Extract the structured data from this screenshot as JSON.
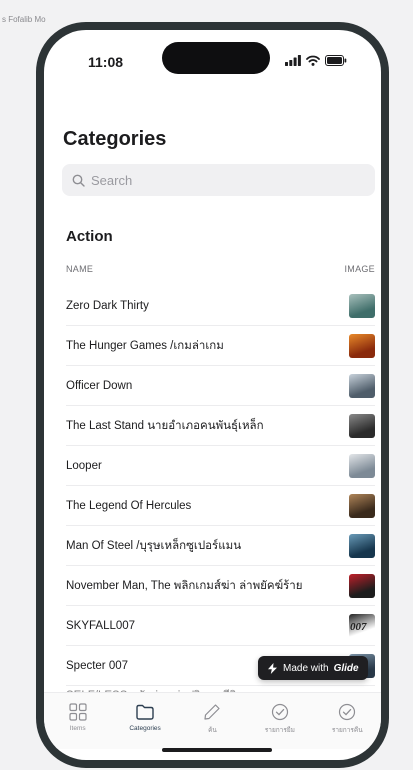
{
  "window": {
    "caption": "s Fofalib Mo"
  },
  "status_bar": {
    "time": "11:08"
  },
  "page": {
    "title": "Categories"
  },
  "search": {
    "placeholder": "Search"
  },
  "section": {
    "title": "Action",
    "columns": {
      "name": "NAME",
      "image": "IMAGE"
    }
  },
  "rows": [
    {
      "name": "Zero Dark Thirty",
      "thumb_colors": [
        "#3f6e6a",
        "#a9c1bd"
      ]
    },
    {
      "name": "The Hunger Games /เกมล่าเกม",
      "thumb_colors": [
        "#8a2a0c",
        "#e98a2a"
      ]
    },
    {
      "name": "Officer Down",
      "thumb_colors": [
        "#4f5d6a",
        "#c8d2db"
      ]
    },
    {
      "name": "The Last Stand นายอำเภอคนพันธุ์เหล็ก",
      "thumb_colors": [
        "#2b2b2b",
        "#8a8a8a"
      ]
    },
    {
      "name": "Looper",
      "thumb_colors": [
        "#7d8a96",
        "#e3e6e9"
      ]
    },
    {
      "name": "The Legend Of Hercules",
      "thumb_colors": [
        "#3a2a1c",
        "#b0865a"
      ]
    },
    {
      "name": "Man Of Steel /บุรุษเหล็กซูเปอร์แมน",
      "thumb_colors": [
        "#16364d",
        "#6a9bb8"
      ]
    },
    {
      "name": "November Man, The พลิกเกมส์ฆ่า ล่าพยัคฆ์ร้าย",
      "thumb_colors": [
        "#1d1d1d",
        "#c0202a"
      ]
    },
    {
      "name": "SKYFALL007",
      "thumb_colors": [
        "#ffffff",
        "#222222"
      ],
      "thumb_text": "007"
    },
    {
      "name": "Specter 007",
      "thumb_colors": [
        "#2a3a4a",
        "#7f97ab"
      ]
    }
  ],
  "partial_row": {
    "name": "SELF/LESS สลับร่าง ล่าปริศนาชีวิตอมตะ"
  },
  "badge": {
    "prefix": "Made with",
    "brand": "Glide"
  },
  "tabs": [
    {
      "label": "Items",
      "icon": "grid-icon"
    },
    {
      "label": "Categories",
      "icon": "folder-icon",
      "active": true
    },
    {
      "label": "ค้น",
      "icon": "pencil-icon"
    },
    {
      "label": "รายการยืม",
      "icon": "check-circle-icon"
    },
    {
      "label": "รายการคืน",
      "icon": "check-circle-icon"
    }
  ],
  "colors": {
    "accent": "#2c3e50",
    "frame": "#2d3436",
    "badge": "#1f1f22"
  }
}
